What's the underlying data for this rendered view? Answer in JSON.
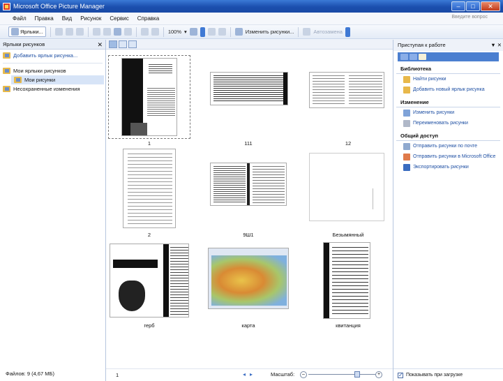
{
  "window": {
    "title": "Microsoft Office Picture Manager",
    "controls": {
      "minimize": "–",
      "maximize": "□",
      "close": "✕"
    }
  },
  "menu": {
    "items": [
      "Файл",
      "Правка",
      "Вид",
      "Рисунок",
      "Сервис",
      "Справка"
    ],
    "ask_placeholder": "Введите вопрос"
  },
  "toolbar": {
    "shortcuts_label": "Ярлыки...",
    "zoom_value": "100%",
    "edit_label": "Изменить рисунки...",
    "autocorrect_label": "Автозамена"
  },
  "left_pane": {
    "header": "Ярлыки рисунков",
    "add_shortcut": "Добавить ярлык рисунка...",
    "my_shortcuts": "Мои ярлыки рисунков",
    "my_pictures": "Мои рисунки",
    "unsaved": "Несохраненные изменения",
    "status": "Файлов: 9 (4,67 МБ)"
  },
  "center": {
    "thumbnails": [
      {
        "label": "1"
      },
      {
        "label": "111"
      },
      {
        "label": "12"
      },
      {
        "label": "2"
      },
      {
        "label": "9Ш1"
      },
      {
        "label": "Безымянный"
      },
      {
        "label": "герб"
      },
      {
        "label": "карта"
      },
      {
        "label": "квитанция"
      }
    ],
    "page_status": "1",
    "zoom_label": "Масштаб:",
    "zoom_minus": "–",
    "zoom_plus": "+",
    "zoom_level": 0.7
  },
  "right_pane": {
    "header": "Приступая к работе",
    "sections": [
      {
        "title": "Библиотека",
        "links": [
          "Найти рисунки",
          "Добавить новый ярлык рисунка"
        ]
      },
      {
        "title": "Изменение",
        "links": [
          "Изменить рисунки",
          "Переименовать рисунки"
        ]
      },
      {
        "title": "Общий доступ",
        "links": [
          "Отправить рисунки по почте",
          "Отправить рисунки в Microsoft Office",
          "Экспортировать рисунки"
        ]
      }
    ],
    "footer_checkbox": "Показывать при загрузке",
    "footer_checked": true
  },
  "colors": {
    "title_bar": "#1b4fae",
    "link": "#1e4fa3",
    "selection": "#d7e4f7"
  }
}
